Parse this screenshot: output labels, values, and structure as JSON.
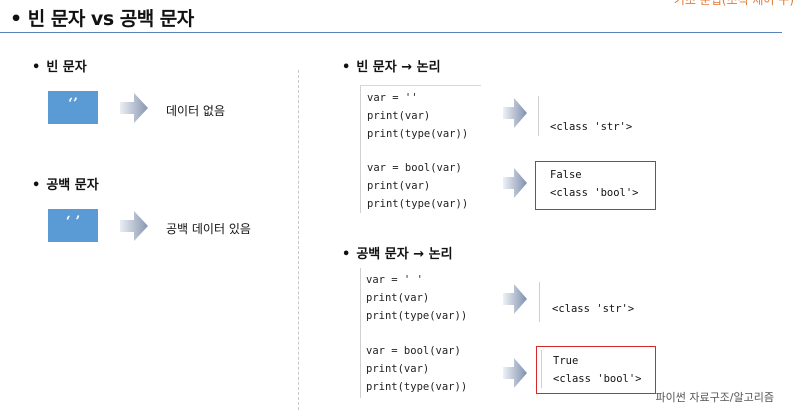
{
  "page": {
    "title": "• 빈 문자 vs 공백 문자",
    "corner_text": "기초 문법(조직 제어 구)"
  },
  "left": {
    "empty": {
      "heading": "빈 문자",
      "box_symbol": "‘’",
      "description": "데이터 없음"
    },
    "space": {
      "heading": "공백 문자",
      "box_symbol": "‘ ’",
      "description": "공백 데이터 있음"
    }
  },
  "right": {
    "empty": {
      "heading": "빈 문자 → 논리",
      "code1": [
        "var = ''",
        "print(var)",
        "print(type(var))"
      ],
      "output1": [
        "",
        "<class 'str'>"
      ],
      "code2": [
        "var = bool(var)",
        "print(var)",
        "print(type(var))"
      ],
      "output2": [
        "False",
        "<class 'bool'>"
      ]
    },
    "space": {
      "heading": "공백 문자 → 논리",
      "code1": [
        "var = ' '",
        "print(var)",
        "print(type(var))"
      ],
      "output1": [
        "",
        "<class 'str'>"
      ],
      "code2": [
        "var = bool(var)",
        "print(var)",
        "print(type(var))"
      ],
      "output2": [
        "True",
        "<class 'bool'>"
      ]
    }
  },
  "footer": "파이썬 자료구조/알고리즘",
  "colors": {
    "accent_blue": "#5b9bd5",
    "highlight_red": "#d62828",
    "title_rule": "#5a84b8"
  },
  "icons": {
    "arrow": "chevron-arrow-icon"
  }
}
